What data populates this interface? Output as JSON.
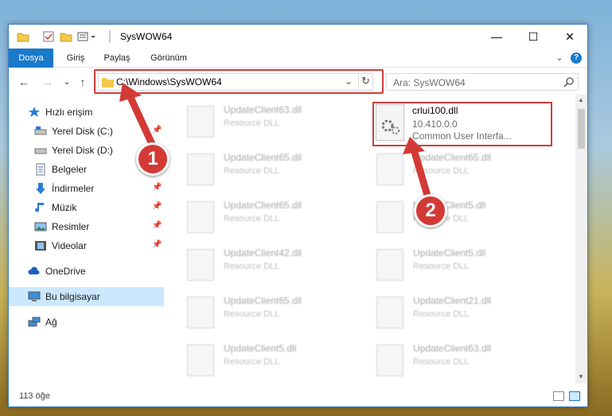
{
  "window": {
    "title": "SysWOW64",
    "minimize": "—",
    "maximize": "☐",
    "close": "✕"
  },
  "ribbon": {
    "tabs": [
      {
        "label": "Dosya"
      },
      {
        "label": "Giriş"
      },
      {
        "label": "Paylaş"
      },
      {
        "label": "Görünüm"
      }
    ],
    "expand": "⌄",
    "help": "?"
  },
  "nav": {
    "back": "←",
    "forward": "→",
    "recent": "⌄",
    "up": "↑",
    "address": "C:\\Windows\\SysWOW64",
    "dropdown": "⌄",
    "refresh": "↻",
    "search_placeholder": "Ara: SysWOW64"
  },
  "sidebar": {
    "items": [
      {
        "label": "Hızlı erişim",
        "icon": "star-icon"
      },
      {
        "label": "Yerel Disk (C:)",
        "icon": "drive-icon",
        "pinned": true
      },
      {
        "label": "Yerel Disk (D:)",
        "icon": "drive-icon"
      },
      {
        "label": "Belgeler",
        "icon": "documents-icon",
        "pinned": true
      },
      {
        "label": "İndirmeler",
        "icon": "download-icon",
        "pinned": true
      },
      {
        "label": "Müzik",
        "icon": "music-icon",
        "pinned": true
      },
      {
        "label": "Resimler",
        "icon": "pictures-icon",
        "pinned": true
      },
      {
        "label": "Videolar",
        "icon": "video-icon",
        "pinned": true
      },
      {
        "label": "OneDrive",
        "icon": "cloud-icon"
      },
      {
        "label": "Bu bilgisayar",
        "icon": "computer-icon"
      },
      {
        "label": "Ağ",
        "icon": "network-icon"
      }
    ]
  },
  "files_left": [
    {
      "name": "UpdateClient63.dll",
      "type": "Resource DLL"
    },
    {
      "name": "UpdateClient65.dll",
      "type": "Resource DLL"
    },
    {
      "name": "UpdateClient65.dll",
      "type": "Resource DLL"
    },
    {
      "name": "UpdateClient42.dll",
      "type": "Resource DLL"
    },
    {
      "name": "UpdateClient65.dll",
      "type": "Resource DLL"
    },
    {
      "name": "UpdateClient5.dll",
      "type": "Resource DLL"
    }
  ],
  "files_right": [
    {
      "name": "UpdateClient65.dll",
      "type": "Resource DLL"
    },
    {
      "name": "UpdateClient5.dll",
      "type": "Resource DLL"
    },
    {
      "name": "UpdateClient5.dll",
      "type": "Resource DLL"
    },
    {
      "name": "UpdateClient21.dll",
      "type": "Resource DLL"
    },
    {
      "name": "UpdateClient63.dll",
      "type": "Resource DLL"
    }
  ],
  "target_file": {
    "name": "crlui100.dll",
    "version": "10.410.0.0",
    "description": "Common User Interfa..."
  },
  "status": {
    "count": "113 öğe"
  },
  "annotations": {
    "step1": "1",
    "step2": "2"
  },
  "colors": {
    "accent": "#1979ca",
    "highlight": "#d23c3c",
    "selection": "#cce8ff"
  }
}
